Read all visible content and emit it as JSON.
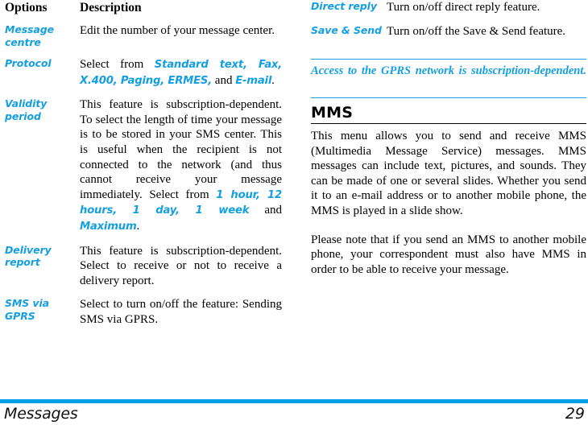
{
  "document": {
    "footer_title": "Messages",
    "page_number": "29",
    "accent_color": "#139FE0",
    "footer_rule_color": "#009FE8",
    "text_color": "#000000"
  },
  "left_column": {
    "table_headers": {
      "options": "Options",
      "description": "Description"
    },
    "rows": [
      {
        "term": "Message centre",
        "description": "Edit the number of your message center."
      },
      {
        "term": "Protocol",
        "description_parts": [
          {
            "text": "Select from ",
            "style": "plain"
          },
          {
            "text": "Standard text, Fax, X.400, Paging, ERMES,",
            "style": "blue"
          },
          {
            "text": " and ",
            "style": "plain"
          },
          {
            "text": "E-mail",
            "style": "blue"
          },
          {
            "text": ".",
            "style": "plain"
          }
        ]
      },
      {
        "term": "Validity period",
        "description_parts": [
          {
            "text": "This feature is subscription-dependent. To select the length of time your message is to be stored in your SMS center. This is useful when the recipient is not connected to the network (and thus cannot receive your message immediately. Select from ",
            "style": "plain"
          },
          {
            "text": "1 hour, 12 hours, 1 day, 1 week",
            "style": "blue"
          },
          {
            "text": " and ",
            "style": "plain"
          },
          {
            "text": "Maximum",
            "style": "blue"
          },
          {
            "text": ".",
            "style": "plain"
          }
        ]
      },
      {
        "term": "Delivery report",
        "description": "This feature is subscription-dependent. Select to receive or not to receive a delivery report."
      },
      {
        "term": "SMS via GPRS",
        "description": "Select to turn on/off the feature: Sending SMS via GPRS."
      }
    ]
  },
  "right_column": {
    "rows": [
      {
        "term": "Direct reply",
        "description": "Turn on/off direct reply feature."
      },
      {
        "term": "Save & Send",
        "description": "Turn on/off the Save & Send feature."
      }
    ],
    "note": "Access to the GPRS network is subscription-dependent.",
    "section": {
      "title": "MMS",
      "paragraphs": [
        "This menu allows you to send and receive MMS (Multimedia Message Service) messages. MMS messages can include text, pictures, and sounds. They can be made of one or several slides. Whether you send it to an e-mail address or to another mobile phone, the MMS is played in a slide show.",
        "Please note that if you send an MMS to another mobile phone, your correspondent must also have MMS in order to be able to receive your message."
      ]
    }
  }
}
